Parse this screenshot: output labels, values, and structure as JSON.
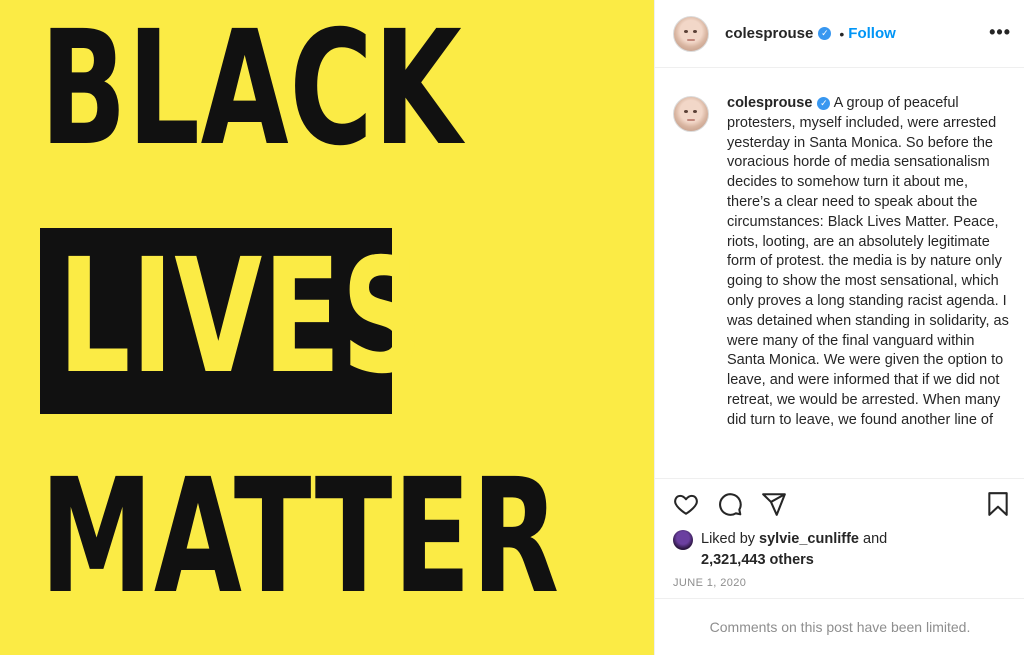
{
  "image": {
    "background_color": "#fbeb45",
    "lines": [
      "BLACK",
      "LIVES",
      "MATTER"
    ]
  },
  "header": {
    "username": "colesprouse",
    "separator": "•",
    "follow_label": "Follow",
    "more_label": "•••"
  },
  "caption": {
    "username": "colesprouse",
    "text": "A group of peaceful protesters, myself included, were arrested yesterday in Santa Monica. So before the voracious horde of media sensationalism decides to somehow turn it about me, there’s a clear need to speak about the circumstances: Black Lives Matter. Peace, riots, looting, are an absolutely legitimate form of protest. the media is by nature only going to show the most sensational, which only proves a long standing racist agenda. I was detained when standing in solidarity, as were many of the final vanguard within Santa Monica. We were given the option to leave, and were informed that if we did not retreat, we would be arrested. When many did turn to leave, we found another line of"
  },
  "actions": {
    "icons": [
      "heart-icon",
      "comment-icon",
      "share-icon",
      "bookmark-icon"
    ]
  },
  "likes": {
    "prefix": "Liked by",
    "user": "sylvie_cunliffe",
    "and_label": "and",
    "count": "2,321,443 others"
  },
  "date": "JUNE 1, 2020",
  "comments_notice": "Comments on this post have been limited.",
  "colors": {
    "accent": "#0095f6",
    "verified": "#3897f0",
    "text": "#262626",
    "muted": "#8e8e8e"
  }
}
